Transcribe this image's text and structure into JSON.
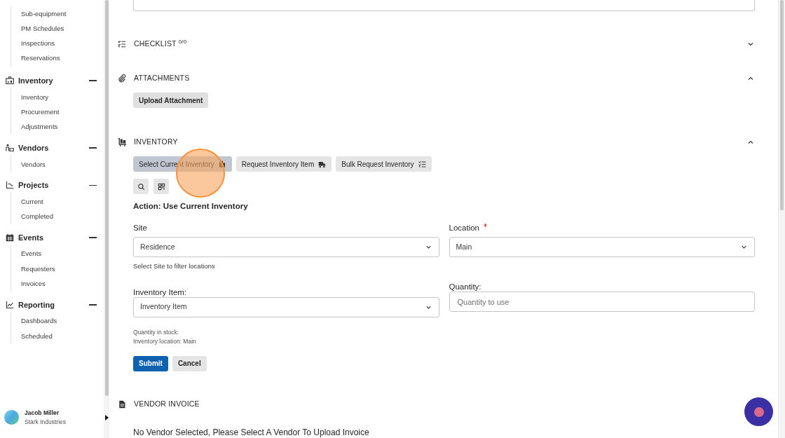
{
  "sidebar": {
    "groups": [
      {
        "items": [
          "Sub-equipment",
          "PM Schedules",
          "Inspections",
          "Reservations"
        ]
      },
      {
        "label": "Inventory",
        "expanded": true,
        "items": [
          "Inventory",
          "Procurement",
          "Adjustments"
        ]
      },
      {
        "label": "Vendors",
        "expanded": true,
        "items": [
          "Vendors"
        ]
      },
      {
        "label": "Projects",
        "expanded": true,
        "items": [
          "Current",
          "Completed"
        ]
      },
      {
        "label": "Events",
        "expanded": true,
        "items": [
          "Events",
          "Requesters",
          "Invoices"
        ]
      },
      {
        "label": "Reporting",
        "expanded": true,
        "items": [
          "Dashboards",
          "Scheduled"
        ]
      }
    ],
    "user": {
      "name": "Jacob Miller",
      "company": "Stark Industries"
    }
  },
  "sections": [
    {
      "kind": "checklist",
      "title": "CHECKLIST $^{0/0}$",
      "expanded": false
    },
    {
      "kind": "attachments",
      "title": "ATTACHMENTS",
      "expanded": true,
      "button": "Upload Attachment"
    },
    {
      "kind": "inventory",
      "title": "INVENTORY",
      "expanded": true,
      "tabs": [
        {
          "label": "Select Current Inventory",
          "selected": true
        },
        {
          "label": "Request Inventory Item",
          "selected": false
        },
        {
          "label": "Bulk Request Inventory",
          "selected": false
        }
      ],
      "action": "Action: Use Current Inventory",
      "site": {
        "label": "Site",
        "value": "Residence",
        "hint": "Select Site to filter locations"
      },
      "location": {
        "label": "Location",
        "required": true,
        "value": "Main"
      },
      "item": {
        "label": "Inventory Item:",
        "value": "Inventory Item"
      },
      "quantity": {
        "label": "Quantity:",
        "placeholder": "Quantity to use"
      },
      "info": [
        "Quantity in stock:",
        "Inventory location: Main"
      ],
      "submit": "Submit",
      "cancel": "Cancel"
    },
    {
      "kind": "vendor_invoice",
      "title": "VENDOR INVOICE",
      "message": "No Vendor Selected, Please Select A Vendor To Upload Invoice"
    }
  ]
}
